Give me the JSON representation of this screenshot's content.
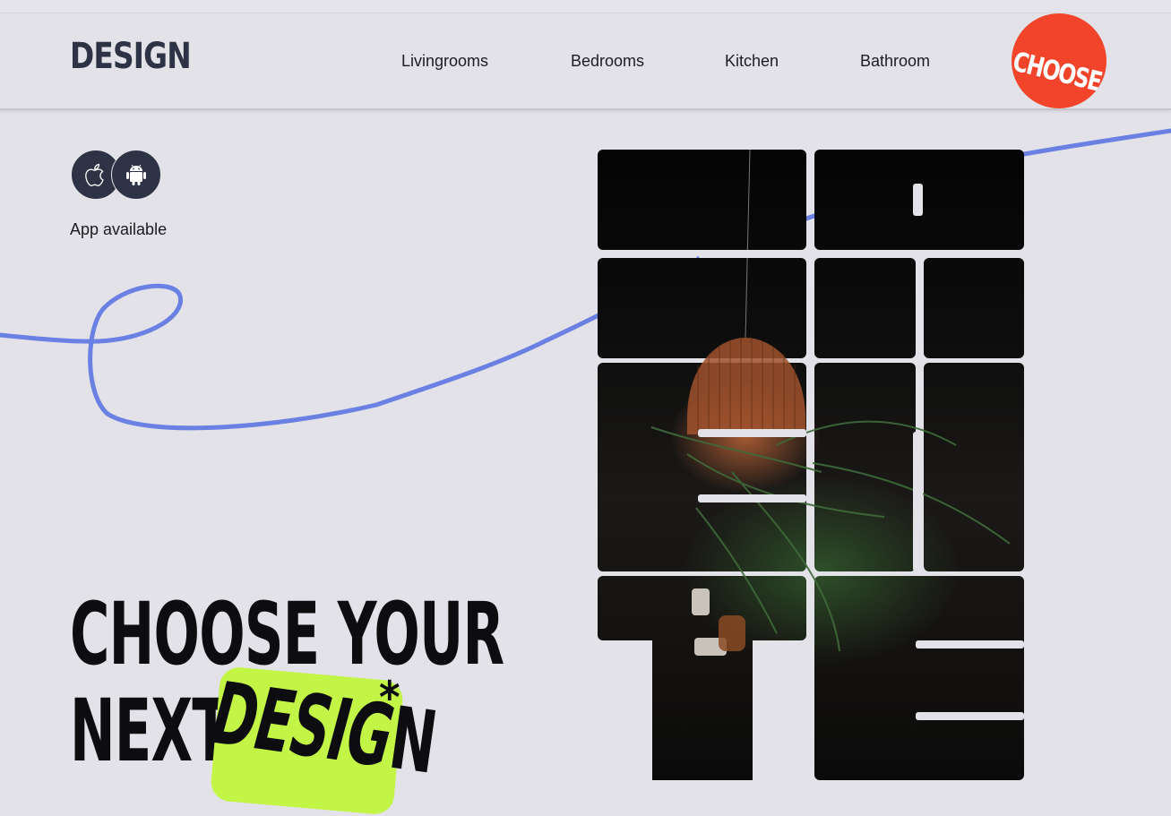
{
  "header": {
    "logo": "DESIGN",
    "nav": [
      "Livingrooms",
      "Bedrooms",
      "Kitchen",
      "Bathroom"
    ],
    "cta_badge": "CHOOSE"
  },
  "apps": {
    "icons": [
      "apple-icon",
      "android-icon"
    ],
    "label": "App available"
  },
  "hero": {
    "line1": "CHOOSE YOUR",
    "line2_prefix": "NEXT",
    "highlight": "DESIG",
    "line2_suffix": "N",
    "asterisk": "*"
  },
  "colors": {
    "background": "#e2e2e8",
    "accent_red": "#f2442a",
    "accent_lime": "#c2f546",
    "line_blue": "#6a80e3",
    "dark": "#2d3344"
  }
}
